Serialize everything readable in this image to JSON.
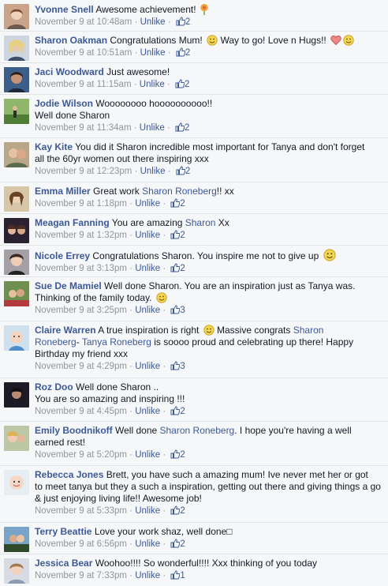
{
  "ui": {
    "unlike": "Unlike",
    "sep": " · "
  },
  "comments": [
    {
      "author": "Yvonne Snell",
      "text": "Awesome achievement!",
      "time": "November 9 at 10:48am",
      "likes": "2",
      "emoji": "flower"
    },
    {
      "author": "Sharon Oakman",
      "text": "Congratulations Mum! ",
      "text2": " Way to go! Love n Hugs!! ",
      "time": "November 9 at 10:51am",
      "likes": "2"
    },
    {
      "author": "Jaci Woodward",
      "text": "Just awesome!",
      "time": "November 9 at 11:15am",
      "likes": "2"
    },
    {
      "author": "Jodie Wilson",
      "text": "Woooooooo hoooooooooo!!",
      "line2": "Well done Sharon",
      "time": "November 9 at 11:34am",
      "likes": "2"
    },
    {
      "author": "Kay Kite",
      "text": "You did it Sharon incredible most important for Tanya and don't forget",
      "line2": "all the 60yr women out there inspiring xxx",
      "time": "November 9 at 12:23pm",
      "likes": "2"
    },
    {
      "author": "Emma Miller",
      "text": "Great work ",
      "mention": "Sharon Roneberg",
      "text3": "!! xx",
      "time": "November 9 at 1:18pm",
      "likes": "2"
    },
    {
      "author": "Meagan Fanning",
      "text": "You are amazing ",
      "mention": "Sharon",
      "text3": " Xx",
      "time": "November 9 at 1:32pm",
      "likes": "2"
    },
    {
      "author": "Nicole Errey",
      "text": "Congratulations Sharon. You inspire me not to give up ",
      "time": "November 9 at 3:13pm",
      "likes": "2"
    },
    {
      "author": "Sue De Mamiel",
      "text": "Well done Sharon. You are an inspiration just as Tanya was.",
      "line2": "Thinking of the family today. ",
      "time": "November 9 at 3:25pm",
      "likes": "3"
    },
    {
      "author": "Claire Warren",
      "text": "A true inspiration is right ",
      "text2": " Massive congrats ",
      "mention": "Sharon",
      "mention2": "Roneberg",
      "text3": "- ",
      "mention3": "Tanya Roneberg",
      "text4": " is soooo proud and celebrating up there! Happy",
      "line3": "Birthday my friend xxx",
      "time": "November 9 at 4:29pm",
      "likes": "3"
    },
    {
      "author": "Roz Doo",
      "text": "Well done Sharon ..",
      "line2": "You are so amazing and inspiring !!!",
      "time": "November 9 at 4:45pm",
      "likes": "2"
    },
    {
      "author": "Emily Boodnikoff",
      "text": "Well done ",
      "mention": "Sharon Roneberg",
      "text3": ". I hope you're having a well",
      "line2": "earned rest!",
      "time": "November 9 at 5:20pm",
      "likes": "2"
    },
    {
      "author": "Rebecca Jones",
      "text": "Brett, you have such a amazing mum! Ive never met her or got",
      "line2": "to meet tanya but they a such a inspiration, getting out there and giving things a go",
      "line3": "& just enjoying living life!! Awesome job!",
      "time": "November 9 at 5:33pm",
      "likes": "2"
    },
    {
      "author": "Terry Beattie",
      "text": "Love your work shaz, well done□",
      "time": "November 9 at 6:56pm",
      "likes": "2"
    },
    {
      "author": "Jessica Bear",
      "text": "Woohoo!!!! So wonderful!!!! Xxx thinking of you today",
      "time": "November 9 at 7:33pm",
      "likes": "1"
    }
  ],
  "colors": {
    "link": "#3b5998",
    "meta": "#90949c",
    "bg": "#f6f7f9"
  }
}
